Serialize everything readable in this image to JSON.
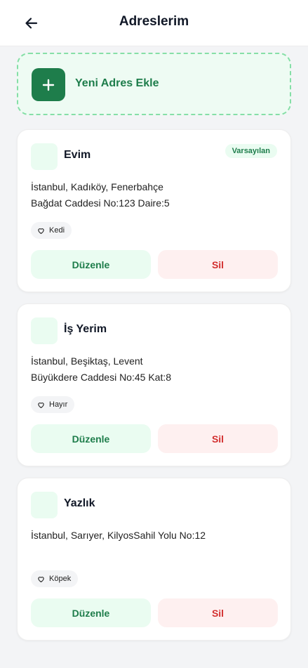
{
  "header": {
    "title": "Adreslerim",
    "back_icon": "arrow-left-icon"
  },
  "add_address": {
    "label": "Yeni Adres Ekle",
    "icon": "plus-icon"
  },
  "addresses": [
    {
      "name": "Evim",
      "badge": "Varsayılan",
      "line1": "İstanbul, Kadıköy, Fenerbahçe",
      "line2": "Bağdat Caddesi No:123 Daire:5",
      "pet": "Kedi",
      "edit_label": "Düzenle",
      "delete_label": "Sil"
    },
    {
      "name": "İş Yerim",
      "line1": "İstanbul, Beşiktaş, Levent",
      "line2": "Büyükdere Caddesi No:45 Kat:8",
      "pet": "Hayır",
      "edit_label": "Düzenle",
      "delete_label": "Sil"
    },
    {
      "name": "Yazlık",
      "line1": "İstanbul, Sarıyer, KilyosSahil Yolu No:12",
      "line2": "",
      "pet": "Köpek",
      "edit_label": "Düzenle",
      "delete_label": "Sil"
    }
  ],
  "colors": {
    "accent": "#1e7d4b",
    "accent_light": "#eafcf1",
    "danger": "#d32f2f",
    "danger_light": "#fef0f0",
    "dashed_border": "#86dfa7"
  }
}
